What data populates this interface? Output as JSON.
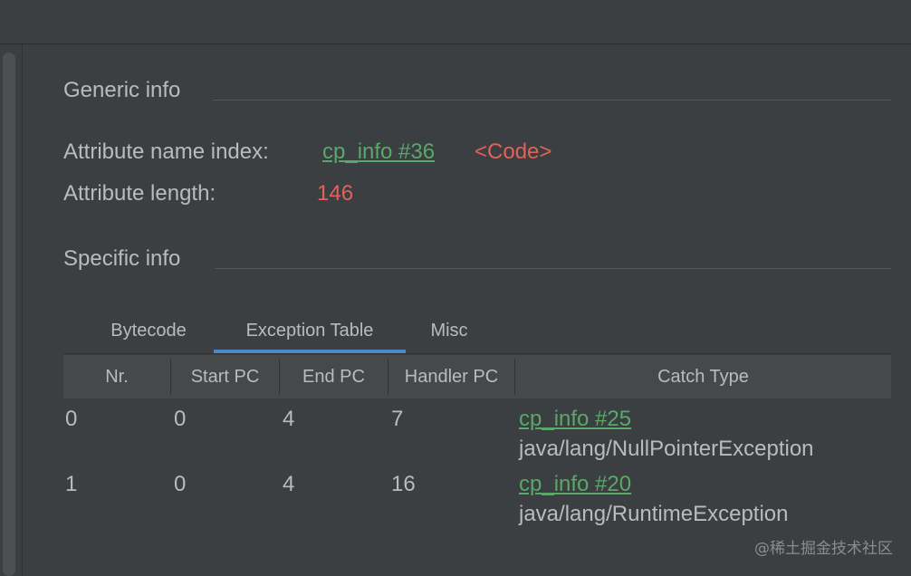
{
  "generic_info": {
    "title": "Generic info",
    "attribute_name_index_label": "Attribute name index:",
    "attribute_name_index_link": "cp_info #36",
    "attribute_name_index_value": "<Code>",
    "attribute_length_label": "Attribute length:",
    "attribute_length_value": "146"
  },
  "specific_info": {
    "title": "Specific info"
  },
  "tabs": [
    {
      "label": "Bytecode",
      "active": false
    },
    {
      "label": "Exception Table",
      "active": true
    },
    {
      "label": "Misc",
      "active": false
    }
  ],
  "table": {
    "columns": [
      "Nr.",
      "Start PC",
      "End PC",
      "Handler PC",
      "Catch Type"
    ],
    "rows": [
      {
        "nr": "0",
        "start_pc": "0",
        "end_pc": "4",
        "handler_pc": "7",
        "catch_link": "cp_info #25",
        "catch_type": "java/lang/NullPointerException"
      },
      {
        "nr": "1",
        "start_pc": "0",
        "end_pc": "4",
        "handler_pc": "16",
        "catch_link": "cp_info #20",
        "catch_type": "java/lang/RuntimeException"
      }
    ]
  },
  "colors": {
    "background": "#3c3f41",
    "link": "#59a869",
    "value_red": "#e0625a",
    "tab_accent": "#4a88c7",
    "header_bg": "#45494a"
  },
  "watermark": "@稀土掘金技术社区"
}
